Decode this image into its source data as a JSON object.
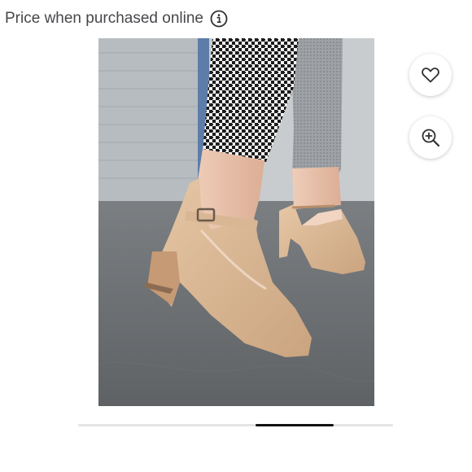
{
  "price_notice": {
    "label": "Price when purchased online",
    "icon": "info-icon"
  },
  "product_image": {
    "subject": "beige suede mary jane block-heel pumps"
  },
  "actions": {
    "favorite": {
      "icon": "heart-icon"
    },
    "zoom": {
      "icon": "zoom-in-icon"
    }
  },
  "image_carousel": {
    "scroll_position": 0.75,
    "visible_fraction": 0.25
  },
  "colors": {
    "text": "#46474a",
    "track": "#e3e4e5",
    "thumb": "#111111"
  }
}
